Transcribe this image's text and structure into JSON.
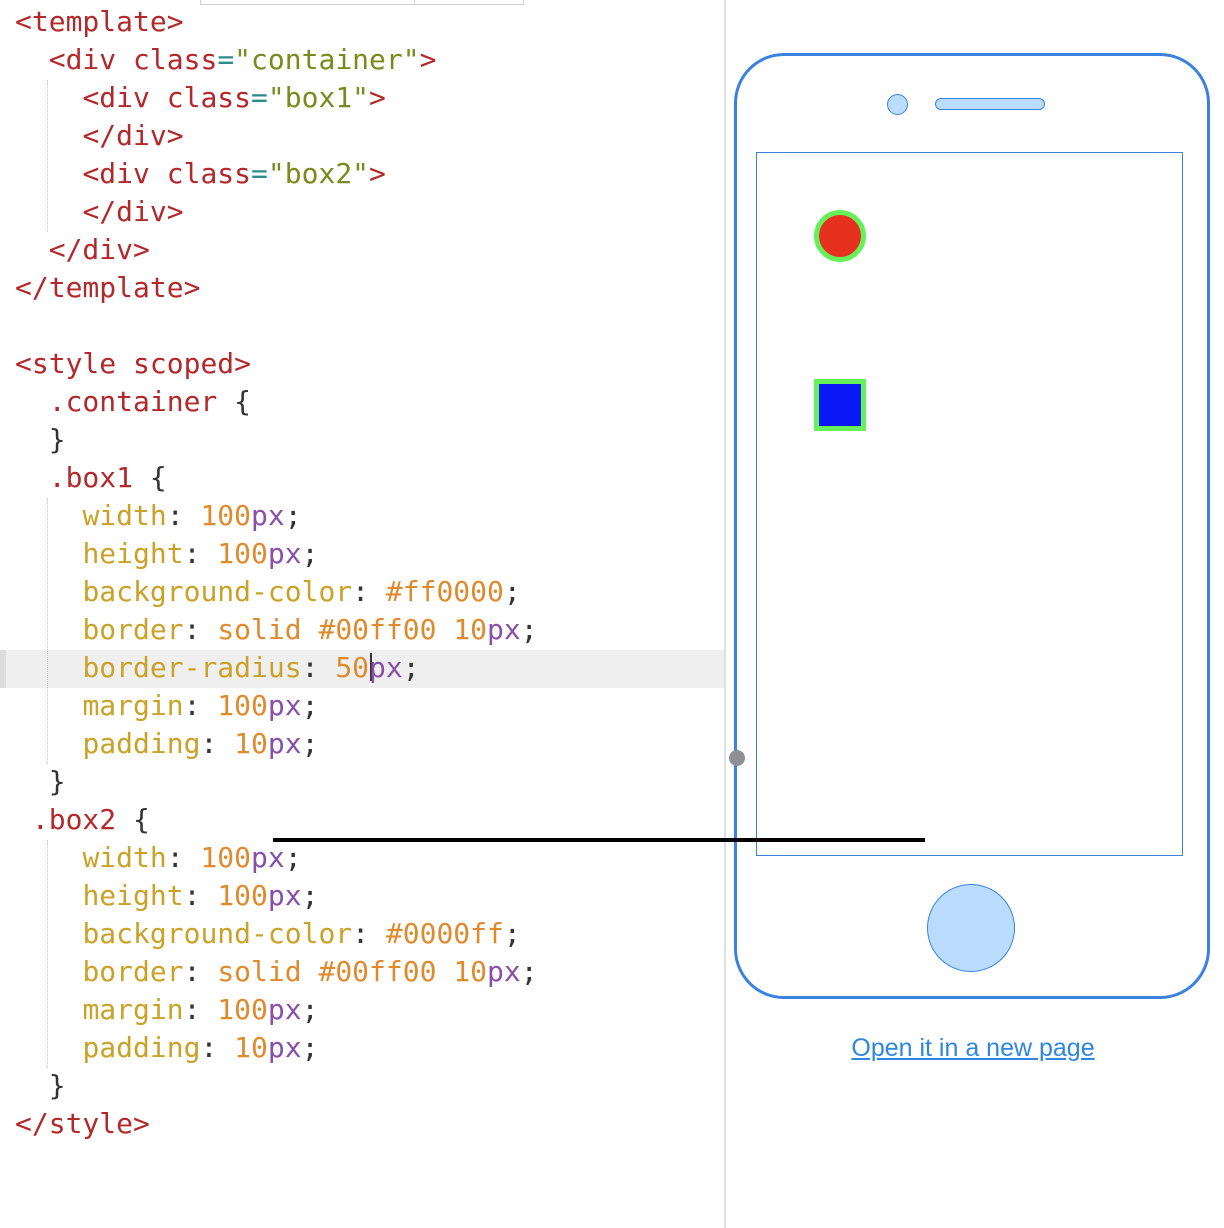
{
  "editor": {
    "code_lines": [
      [
        [
          "t-tag",
          "<template>"
        ]
      ],
      [
        [
          "t-punc",
          "  "
        ],
        [
          "t-tag",
          "<div "
        ],
        [
          "t-attr",
          "class"
        ],
        [
          "t-eq",
          "="
        ],
        [
          "t-str",
          "\"container\""
        ],
        [
          "t-tag",
          ">"
        ]
      ],
      [
        [
          "t-punc",
          "    "
        ],
        [
          "t-tag",
          "<div "
        ],
        [
          "t-attr",
          "class"
        ],
        [
          "t-eq",
          "="
        ],
        [
          "t-str",
          "\"box1\""
        ],
        [
          "t-tag",
          ">"
        ]
      ],
      [
        [
          "t-punc",
          "    "
        ],
        [
          "t-tag",
          "</div>"
        ]
      ],
      [
        [
          "t-punc",
          "    "
        ],
        [
          "t-tag",
          "<div "
        ],
        [
          "t-attr",
          "class"
        ],
        [
          "t-eq",
          "="
        ],
        [
          "t-str",
          "\"box2\""
        ],
        [
          "t-tag",
          ">"
        ]
      ],
      [
        [
          "t-punc",
          "    "
        ],
        [
          "t-tag",
          "</div>"
        ]
      ],
      [
        [
          "t-punc",
          "  "
        ],
        [
          "t-tag",
          "</div>"
        ]
      ],
      [
        [
          "t-tag",
          "</template>"
        ]
      ],
      [],
      [
        [
          "t-tag",
          "<style "
        ],
        [
          "t-attr",
          "scoped"
        ],
        [
          "t-tag",
          ">"
        ]
      ],
      [
        [
          "t-punc",
          "  "
        ],
        [
          "t-sel",
          ".container"
        ],
        [
          "t-brace",
          " {"
        ]
      ],
      [
        [
          "t-punc",
          "  "
        ],
        [
          "t-brace",
          "}"
        ]
      ],
      [
        [
          "t-punc",
          "  "
        ],
        [
          "t-sel",
          ".box1"
        ],
        [
          "t-brace",
          " {"
        ]
      ],
      [
        [
          "t-punc",
          "    "
        ],
        [
          "t-prop",
          "width"
        ],
        [
          "t-punc",
          ": "
        ],
        [
          "t-num",
          "100"
        ],
        [
          "t-unit",
          "px"
        ],
        [
          "t-punc",
          ";"
        ]
      ],
      [
        [
          "t-punc",
          "    "
        ],
        [
          "t-prop",
          "height"
        ],
        [
          "t-punc",
          ": "
        ],
        [
          "t-num",
          "100"
        ],
        [
          "t-unit",
          "px"
        ],
        [
          "t-punc",
          ";"
        ]
      ],
      [
        [
          "t-punc",
          "    "
        ],
        [
          "t-prop",
          "background-color"
        ],
        [
          "t-punc",
          ": "
        ],
        [
          "t-hex",
          "#ff0000"
        ],
        [
          "t-punc",
          ";"
        ]
      ],
      [
        [
          "t-punc",
          "    "
        ],
        [
          "t-prop",
          "border"
        ],
        [
          "t-punc",
          ": "
        ],
        [
          "t-kw",
          "solid "
        ],
        [
          "t-hex",
          "#00ff00 "
        ],
        [
          "t-num",
          "10"
        ],
        [
          "t-unit",
          "px"
        ],
        [
          "t-punc",
          ";"
        ]
      ],
      [
        [
          "t-punc",
          "    "
        ],
        [
          "t-prop",
          "border-radius"
        ],
        [
          "t-punc",
          ": "
        ],
        [
          "t-num",
          "50"
        ],
        [
          "cursor",
          ""
        ],
        [
          "t-unit",
          "px"
        ],
        [
          "t-punc",
          ";"
        ]
      ],
      [
        [
          "t-punc",
          "    "
        ],
        [
          "t-prop",
          "margin"
        ],
        [
          "t-punc",
          ": "
        ],
        [
          "t-num",
          "100"
        ],
        [
          "t-unit",
          "px"
        ],
        [
          "t-punc",
          ";"
        ]
      ],
      [
        [
          "t-punc",
          "    "
        ],
        [
          "t-prop",
          "padding"
        ],
        [
          "t-punc",
          ": "
        ],
        [
          "t-num",
          "10"
        ],
        [
          "t-unit",
          "px"
        ],
        [
          "t-punc",
          ";"
        ]
      ],
      [
        [
          "t-punc",
          "  "
        ],
        [
          "t-brace",
          "}"
        ]
      ],
      [
        [
          "t-punc",
          " "
        ],
        [
          "t-sel",
          ".box2"
        ],
        [
          "t-brace",
          " {"
        ]
      ],
      [
        [
          "t-punc",
          "    "
        ],
        [
          "t-prop",
          "width"
        ],
        [
          "t-punc",
          ": "
        ],
        [
          "t-num",
          "100"
        ],
        [
          "t-unit",
          "px"
        ],
        [
          "t-punc",
          ";"
        ]
      ],
      [
        [
          "t-punc",
          "    "
        ],
        [
          "t-prop",
          "height"
        ],
        [
          "t-punc",
          ": "
        ],
        [
          "t-num",
          "100"
        ],
        [
          "t-unit",
          "px"
        ],
        [
          "t-punc",
          ";"
        ]
      ],
      [
        [
          "t-punc",
          "    "
        ],
        [
          "t-prop",
          "background-color"
        ],
        [
          "t-punc",
          ": "
        ],
        [
          "t-hex",
          "#0000ff"
        ],
        [
          "t-punc",
          ";"
        ]
      ],
      [
        [
          "t-punc",
          "    "
        ],
        [
          "t-prop",
          "border"
        ],
        [
          "t-punc",
          ": "
        ],
        [
          "t-kw",
          "solid "
        ],
        [
          "t-hex",
          "#00ff00 "
        ],
        [
          "t-num",
          "10"
        ],
        [
          "t-unit",
          "px"
        ],
        [
          "t-punc",
          ";"
        ]
      ],
      [
        [
          "t-punc",
          "    "
        ],
        [
          "t-prop",
          "margin"
        ],
        [
          "t-punc",
          ": "
        ],
        [
          "t-num",
          "100"
        ],
        [
          "t-unit",
          "px"
        ],
        [
          "t-punc",
          ";"
        ]
      ],
      [
        [
          "t-punc",
          "    "
        ],
        [
          "t-prop",
          "padding"
        ],
        [
          "t-punc",
          ": "
        ],
        [
          "t-num",
          "10"
        ],
        [
          "t-unit",
          "px"
        ],
        [
          "t-punc",
          ";"
        ]
      ],
      [
        [
          "t-punc",
          "  "
        ],
        [
          "t-brace",
          "}"
        ]
      ],
      [
        [
          "t-tag",
          "</style>"
        ]
      ]
    ],
    "active_line": 18
  },
  "preview": {
    "device": "iphone",
    "box1": {
      "background": "#ff0000",
      "border": "#00ff00",
      "shape": "circle"
    },
    "box2": {
      "background": "#0000ff",
      "border": "#00ff00",
      "shape": "square"
    },
    "open_link_label": "Open it in a new page"
  },
  "colors": {
    "phone_outline": "#3b82e0",
    "phone_fill": "#b9dcff",
    "link": "#2f86e0"
  }
}
